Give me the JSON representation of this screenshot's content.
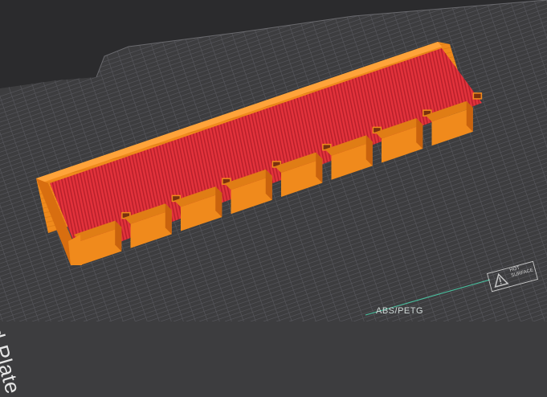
{
  "build_plate": {
    "label": "PEI Textured Plate",
    "material": "ABS/PETG",
    "warning": "HOT SURFACE"
  },
  "model": {
    "slot_count": 8,
    "colors": {
      "wall": "#f08a1c",
      "wall_shade": "#d86e10",
      "infill": "#e2323b",
      "infill_dark": "#b51f2a",
      "plate": "#3d3d3f",
      "grid": "#5a5a5c",
      "outer": "#2b2b2d"
    }
  }
}
